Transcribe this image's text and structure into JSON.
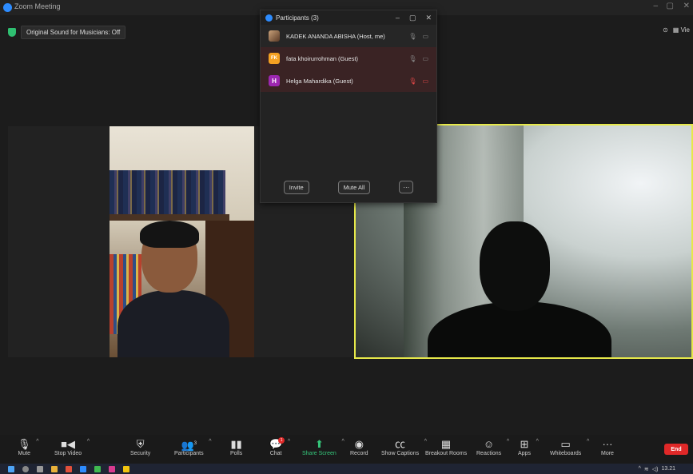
{
  "window": {
    "title": "Zoom Meeting"
  },
  "notice": {
    "label": "Original Sound for Musicians: Off"
  },
  "top_right": {
    "view_label": "Vie"
  },
  "participants_panel": {
    "title": "Participants (3)",
    "participants": [
      {
        "initials": "",
        "name": "KADEK ANANDA ABISHA (Host, me)",
        "mic_muted": false,
        "video_off": false
      },
      {
        "initials": "FK",
        "name": "fata khoirurrohman (Guest)",
        "mic_muted": false,
        "video_off": false
      },
      {
        "initials": "H",
        "name": "Helga Mahardika (Guest)",
        "mic_muted": true,
        "video_off": true
      }
    ],
    "invite_label": "Invite",
    "mute_all_label": "Mute All",
    "more_label": "···"
  },
  "toolbar": {
    "mute": "Mute",
    "stop_video": "Stop Video",
    "security": "Security",
    "participants": "Participants",
    "participants_count": "3",
    "polls": "Polls",
    "chat": "Chat",
    "chat_badge": "1",
    "share_screen": "Share Screen",
    "record": "Record",
    "show_captions": "Show Captions",
    "breakout_rooms": "Breakout Rooms",
    "reactions": "Reactions",
    "apps": "Apps",
    "whiteboards": "Whiteboards",
    "more": "More",
    "end": "End"
  },
  "taskbar": {
    "time": "13.21"
  },
  "colors": {
    "accent": "#2d8cff",
    "active_speaker": "#e6e84a",
    "end": "#e02828",
    "share": "#35c67a"
  }
}
